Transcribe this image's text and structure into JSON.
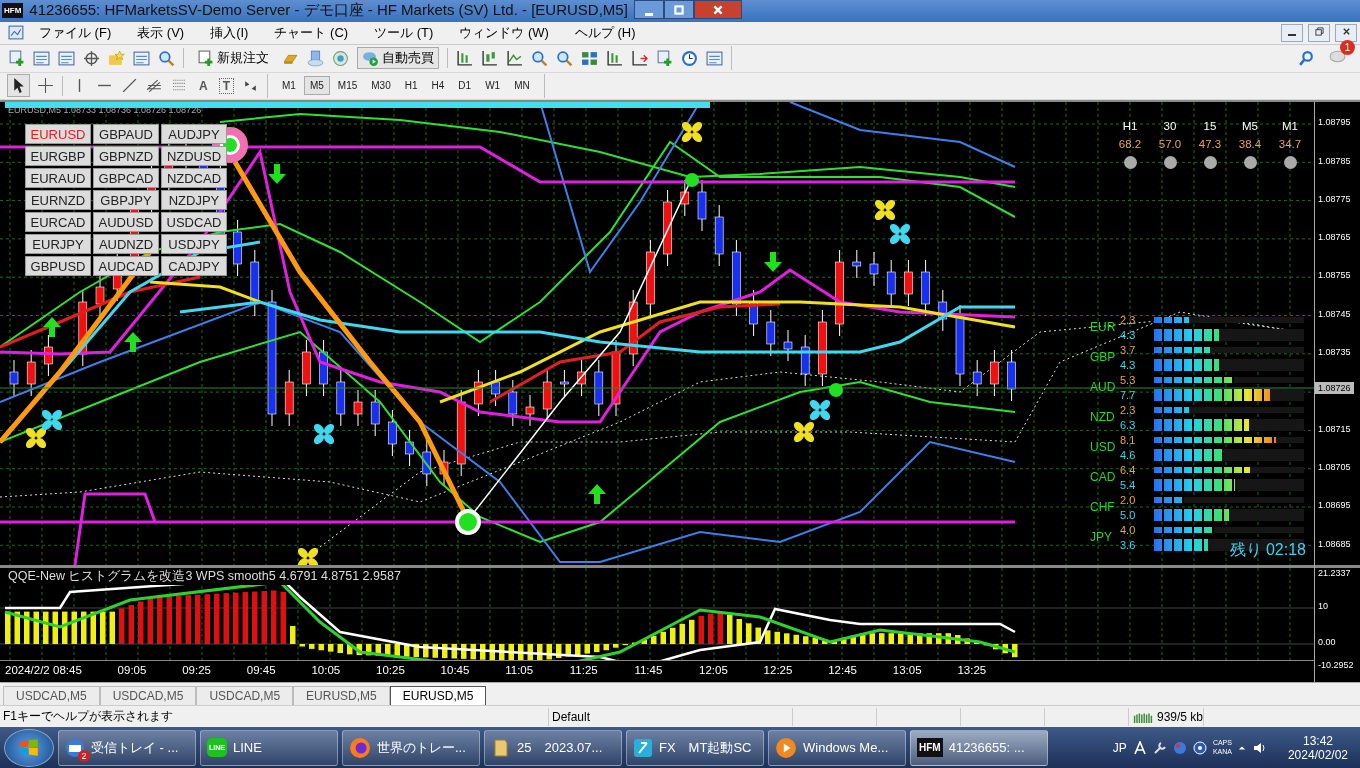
{
  "window": {
    "title": "41236655: HFMarketsSV-Demo Server - デモ口座 - HF Markets (SV) Ltd. - [EURUSD,M5]",
    "app_icon": "HFM"
  },
  "menu": [
    "ファイル (F)",
    "表示 (V)",
    "挿入(I)",
    "チャート (C)",
    "ツール (T)",
    "ウィンドウ (W)",
    "ヘルプ (H)"
  ],
  "toolbar": {
    "new_order": "新規注文",
    "auto_trading": "自動売買",
    "notifications": "1"
  },
  "tool_letters": [
    "A",
    "T"
  ],
  "timeframes": [
    {
      "label": "M1",
      "selected": false
    },
    {
      "label": "M5",
      "selected": true
    },
    {
      "label": "M15",
      "selected": false
    },
    {
      "label": "M30",
      "selected": false
    },
    {
      "label": "H1",
      "selected": false
    },
    {
      "label": "H4",
      "selected": false
    },
    {
      "label": "D1",
      "selected": false
    },
    {
      "label": "W1",
      "selected": false
    },
    {
      "label": "MN",
      "selected": false
    }
  ],
  "chart": {
    "header": "EURUSD,M5 1.08733 1.08736 1.08726 1.08726",
    "pairs": [
      {
        "label": "EURUSD",
        "selected": true
      },
      {
        "label": "GBPAUD",
        "selected": false
      },
      {
        "label": "AUDJPY",
        "selected": false
      },
      {
        "label": "EURGBP",
        "selected": false
      },
      {
        "label": "GBPNZD",
        "selected": false
      },
      {
        "label": "NZDUSD",
        "selected": false
      },
      {
        "label": "EURAUD",
        "selected": false
      },
      {
        "label": "GBPCAD",
        "selected": false
      },
      {
        "label": "NZDCAD",
        "selected": false
      },
      {
        "label": "EURNZD",
        "selected": false
      },
      {
        "label": "GBPJPY",
        "selected": false
      },
      {
        "label": "NZDJPY",
        "selected": false
      },
      {
        "label": "EURCAD",
        "selected": false
      },
      {
        "label": "AUDUSD",
        "selected": false
      },
      {
        "label": "USDCAD",
        "selected": false
      },
      {
        "label": "EURJPY",
        "selected": false
      },
      {
        "label": "AUDNZD",
        "selected": false
      },
      {
        "label": "USDJPY",
        "selected": false
      },
      {
        "label": "GBPUSD",
        "selected": false
      },
      {
        "label": "AUDCAD",
        "selected": false
      },
      {
        "label": "CADJPY",
        "selected": false
      }
    ],
    "price_labels": [
      "1.08795",
      "1.08785",
      "1.08775",
      "1.08765",
      "1.08755",
      "1.08745",
      "1.08735",
      "1.08715",
      "1.08705",
      "1.08695",
      "1.08685"
    ],
    "current_price": "1.08726",
    "timeframe_panel": [
      {
        "label": "H1",
        "value": "68.2"
      },
      {
        "label": "30",
        "value": "57.0"
      },
      {
        "label": "15",
        "value": "47.3"
      },
      {
        "label": "M5",
        "value": "38.4"
      },
      {
        "label": "M1",
        "value": "34.7"
      }
    ],
    "strength": [
      {
        "currency": "EUR",
        "bars": [
          {
            "reading": "2.3",
            "level": 0.23
          },
          {
            "reading": "4.3",
            "level": 0.43
          }
        ]
      },
      {
        "currency": "GBP",
        "bars": [
          {
            "reading": "3.7",
            "level": 0.37
          },
          {
            "reading": "4.3",
            "level": 0.43
          }
        ]
      },
      {
        "currency": "AUD",
        "bars": [
          {
            "reading": "5.3",
            "level": 0.53
          },
          {
            "reading": "7.7",
            "level": 0.77
          }
        ]
      },
      {
        "currency": "NZD",
        "bars": [
          {
            "reading": "2.3",
            "level": 0.23
          },
          {
            "reading": "6.3",
            "level": 0.63
          }
        ]
      },
      {
        "currency": "USD",
        "bars": [
          {
            "reading": "8.1",
            "level": 0.81
          },
          {
            "reading": "4.6",
            "level": 0.46
          }
        ]
      },
      {
        "currency": "CAD",
        "bars": [
          {
            "reading": "6.4",
            "level": 0.64
          },
          {
            "reading": "5.4",
            "level": 0.54
          }
        ]
      },
      {
        "currency": "CHF",
        "bars": [
          {
            "reading": "2.0",
            "level": 0.2
          },
          {
            "reading": "5.0",
            "level": 0.5
          }
        ]
      },
      {
        "currency": "JPY",
        "bars": [
          {
            "reading": "4.0",
            "level": 0.4
          },
          {
            "reading": "3.6",
            "level": 0.36
          }
        ]
      }
    ],
    "countdown": "残り 02:18"
  },
  "indicator": {
    "header": "QQE-New ヒストグラムを改造3 WPS smooth5 4.6791 4.8751 2.9587",
    "axis_labels": [
      "21.2337",
      "10",
      "0.00",
      "-10.2952"
    ]
  },
  "time_labels": [
    "2024/2/2",
    "08:45",
    "09:05",
    "09:25",
    "09:45",
    "10:05",
    "10:25",
    "10:45",
    "11:05",
    "11:25",
    "11:45",
    "12:05",
    "12:25",
    "12:45",
    "13:05",
    "13:25"
  ],
  "chart_tabs": [
    {
      "label": "USDCAD,M5",
      "selected": false
    },
    {
      "label": "USDCAD,M5",
      "selected": false
    },
    {
      "label": "USDCAD,M5",
      "selected": false
    },
    {
      "label": "EURUSD,M5",
      "selected": false
    },
    {
      "label": "EURUSD,M5",
      "selected": true
    }
  ],
  "status_bar": {
    "help": "F1キーでヘルプが表示されます",
    "profile": "Default",
    "traffic": "939/5 kb"
  },
  "taskbar": {
    "items": [
      {
        "kind": "mail",
        "label": "受信トレイ - ...",
        "badge": "2",
        "active": false
      },
      {
        "kind": "line",
        "label": "LINE",
        "icon_text": "LINE",
        "active": false
      },
      {
        "kind": "browser",
        "label": "世界のトレー...",
        "active": false
      },
      {
        "kind": "folder",
        "label": "25　2023.07...",
        "active": false
      },
      {
        "kind": "app",
        "label": "FX　MT起動SC",
        "active": false
      },
      {
        "kind": "media",
        "label": "Windows Me...",
        "active": false
      },
      {
        "kind": "hfm",
        "label": "41236655: ...",
        "icon_text": "HFM",
        "active": true
      }
    ],
    "tray": {
      "language": "JP",
      "caps": "CAPS",
      "kana": "KANA",
      "time": "13:42",
      "date": "2024/02/02"
    }
  }
}
